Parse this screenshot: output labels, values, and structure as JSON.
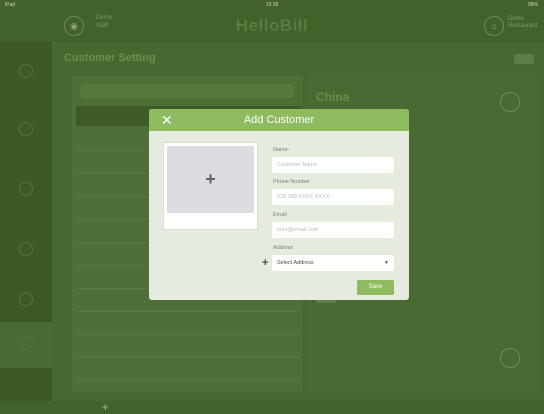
{
  "status_bar": {
    "device": "iPad",
    "time": "13:38",
    "battery": "98%"
  },
  "header": {
    "user_name": "Demo",
    "user_sub": "Staff",
    "logo": "HelloBill",
    "right_line1": "Demo",
    "right_line2": "Restaurant"
  },
  "page": {
    "title": "Customer Setting"
  },
  "detail": {
    "name": "China"
  },
  "list": {
    "add_label": "Add Customer"
  },
  "modal": {
    "close_symbol": "✕",
    "title": "Add Customer",
    "photo_plus": "+",
    "fields": {
      "name_label": "Name:",
      "name_placeholder": "Customer Name",
      "phone_label": "Phone Number",
      "phone_placeholder": "628 388 XXXX XXXX",
      "email_label": "Email",
      "email_placeholder": "your@email.com",
      "address_label": "Address",
      "address_value": "Select Address"
    },
    "address_add": "+",
    "save_label": "Save"
  },
  "colors": {
    "accent": "#8ebb5d",
    "modal_bg": "#e6ebe0",
    "overlay": "#43622a"
  }
}
